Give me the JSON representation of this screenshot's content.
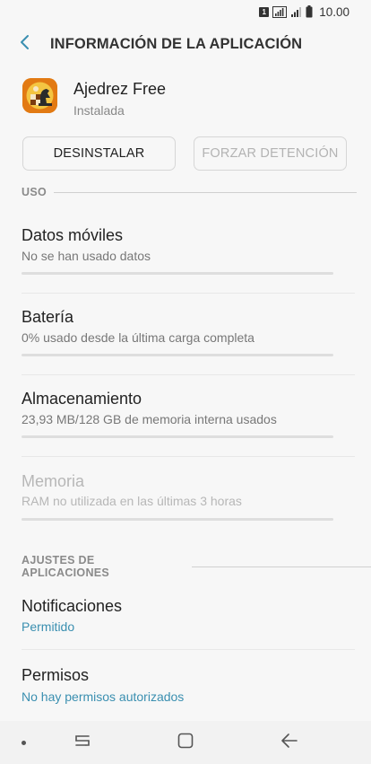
{
  "status_bar": {
    "sim_label": "1",
    "time": "10.00"
  },
  "app_bar": {
    "title": "INFORMACIÓN DE LA APLICACIÓN"
  },
  "app": {
    "name": "Ajedrez Free",
    "status": "Instalada"
  },
  "buttons": {
    "uninstall": "DESINSTALAR",
    "force_stop": "FORZAR DETENCIÓN"
  },
  "sections": {
    "usage": "USO",
    "app_settings": "AJUSTES DE APLICACIONES"
  },
  "usage_items": {
    "mobile_data": {
      "title": "Datos móviles",
      "subtitle": "No se han usado datos"
    },
    "battery": {
      "title": "Batería",
      "subtitle": "0% usado desde la última carga completa"
    },
    "storage": {
      "title": "Almacenamiento",
      "subtitle": "23,93 MB/128 GB de memoria interna usados"
    },
    "memory": {
      "title": "Memoria",
      "subtitle": "RAM no utilizada en las últimas 3 horas"
    }
  },
  "settings_items": {
    "notifications": {
      "title": "Notificaciones",
      "subtitle": "Permitido"
    },
    "permissions": {
      "title": "Permisos",
      "subtitle": "No hay permisos autorizados"
    }
  },
  "colors": {
    "accent": "#3a8fb0",
    "app_icon_bg": "#e27a13"
  }
}
